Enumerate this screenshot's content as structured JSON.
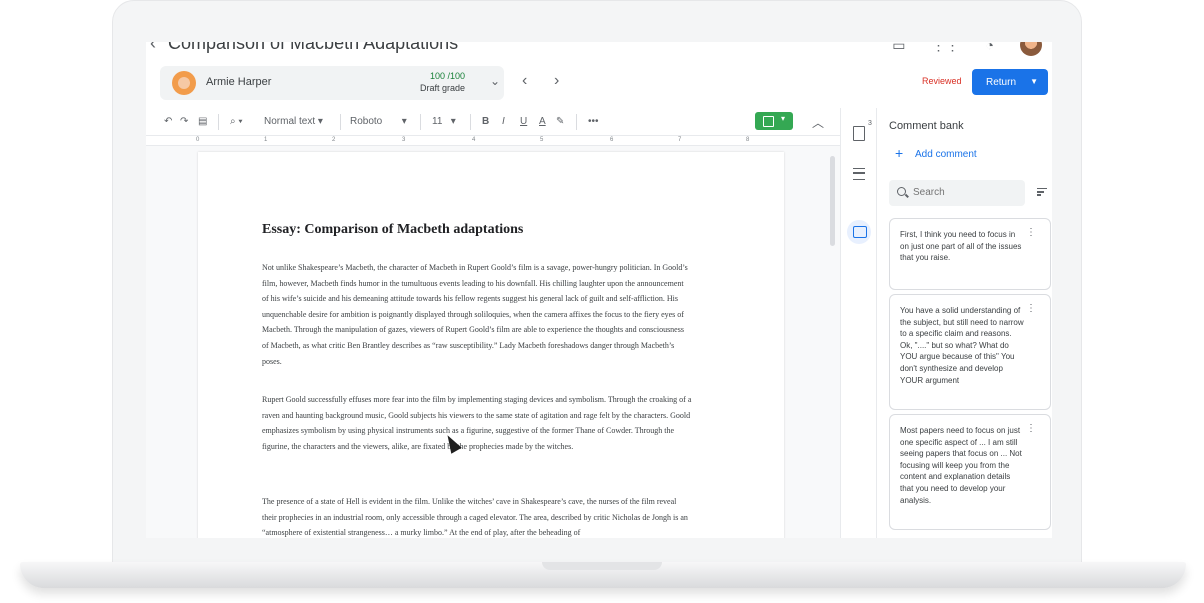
{
  "header": {
    "doc_title": "Comparison of Macbeth Adaptations",
    "student_name": "Armie Harper",
    "grade_score": "100 /100",
    "grade_label": "Draft grade",
    "reviewed": "Reviewed",
    "return_label": "Return"
  },
  "toolbar": {
    "style": "Normal text",
    "font": "Roboto",
    "size": "11",
    "bold": "B",
    "italic": "I",
    "underline": "U",
    "text_color": "A",
    "more": "•••"
  },
  "ruler": [
    "0",
    "1",
    "2",
    "3",
    "4",
    "5",
    "6",
    "7",
    "8"
  ],
  "document": {
    "title": "Essay: Comparison of Macbeth adaptations",
    "paragraphs": [
      "Not unlike Shakespeare’s Macbeth, the character of Macbeth in Rupert Goold’s film is a savage, power-hungry politician. In Goold’s film, however, Macbeth finds humor in the tumultuous events leading to his downfall. His chilling laughter upon the announcement of his wife’s suicide and his demeaning attitude towards his fellow regents suggest his general lack of guilt and self-affliction. His unquenchable desire for ambition is poignantly displayed through soliloquies, when the camera affixes the focus to the fiery eyes of Macbeth. Through the manipulation of gazes, viewers of Rupert Goold’s film are able to experience the thoughts and consciousness of Macbeth, as what critic Ben Brantley describes as “raw susceptibility.” Lady Macbeth foreshadows danger through Macbeth’s poses.",
      "Rupert Goold successfully effuses more fear into the film by implementing staging devices and symbolism. Through the croaking of a raven and haunting background music, Goold subjects his viewers to the same state of agitation and rage felt by the characters. Goold emphasizes symbolism by using physical instruments such as a figurine, suggestive of the former Thane of Cowder. Through the figurine, the characters and the viewers, alike, are fixated by the prophecies made by the witches.",
      "The presence of a state of Hell is evident in the film. Unlike the witches’ cave in Shakespeare’s cave, the nurses of the film reveal their prophecies in an industrial room, only accessible through a caged elevator. The area, described by critic Nicholas de Jongh is an “atmosphere of existential strangeness… a murky limbo.” At the end of play, after the beheading of"
    ]
  },
  "side": {
    "doc_count": "3"
  },
  "comment_bank": {
    "title": "Comment bank",
    "add_label": "Add comment",
    "search_placeholder": "Search",
    "comments": [
      "First, I think you need to focus in on just one part of all of the issues that you raise.",
      "You have a solid understanding of the subject, but still need to narrow to a specific claim and reasons. Ok, \"....\" but so what? What do YOU argue because of this\" You don't synthesize and develop YOUR argument",
      "Most papers need to focus on just one specific aspect of ... I am still seeing papers that focus on ... Not focusing will keep you from the content and explanation details that you need to develop your analysis."
    ]
  },
  "colors": {
    "accent": "#1a73e8",
    "grade_green": "#188038",
    "reviewed_red": "#d93025"
  }
}
